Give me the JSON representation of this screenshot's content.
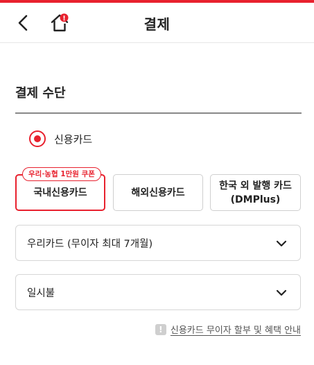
{
  "theme": {
    "brand": "#e8212e"
  },
  "header": {
    "title": "결제",
    "back_icon": "chevron-left-icon",
    "home_icon": "home-icon",
    "home_badge": "!"
  },
  "payment_method": {
    "section_title": "결제 수단",
    "selected_method": "신용카드",
    "card_types": [
      {
        "label": "국내신용카드",
        "selected": true,
        "badge": "우리·농협 1만원 쿠폰"
      },
      {
        "label": "해외신용카드",
        "selected": false
      },
      {
        "label_line1": "한국 외 발행 카드",
        "label_line2": "(DMPlus)",
        "selected": false
      }
    ],
    "card_select": {
      "value": "우리카드 (무이자 최대 7개월)"
    },
    "installment_select": {
      "value": "일시불"
    },
    "info_link": {
      "icon_text": "!",
      "label": "신용카드 무이자 할부 및 혜택 안내"
    }
  }
}
